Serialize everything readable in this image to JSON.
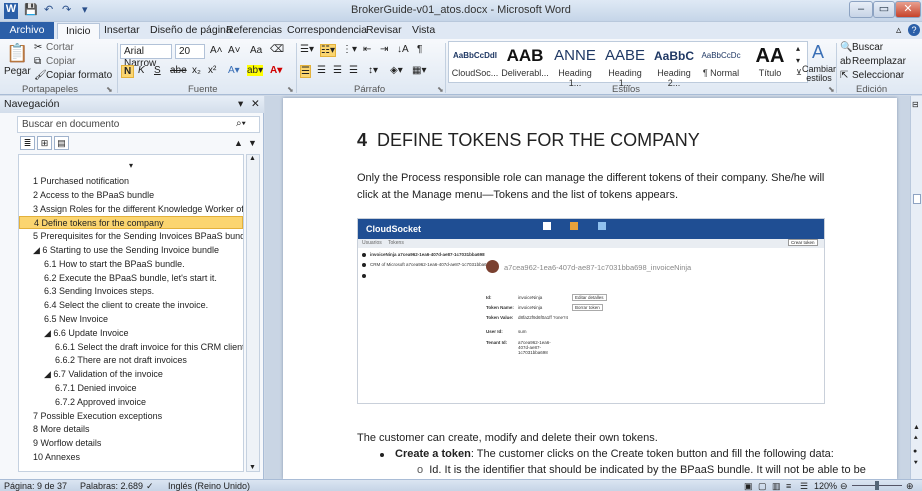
{
  "window": {
    "title": "BrokerGuide-v01_atos.docx - Microsoft Word",
    "app_letter": "W"
  },
  "ribbon_tabs": [
    "Archivo",
    "Inicio",
    "Insertar",
    "Diseño de página",
    "Referencias",
    "Correspondencia",
    "Revisar",
    "Vista"
  ],
  "ribbon": {
    "clipboard": {
      "paste": "Pegar",
      "cut": "Cortar",
      "copy": "Copiar",
      "format_painter": "Copiar formato",
      "label": "Portapapeles"
    },
    "font": {
      "name": "Arial Narrow",
      "size": "20",
      "bold": "N",
      "italic": "K",
      "underline": "S",
      "strike": "abe",
      "sub": "x₂",
      "sup": "x²",
      "grow": "A˄",
      "shrink": "A˅",
      "case": "Aa",
      "label": "Fuente"
    },
    "paragraph": {
      "label": "Párrafo"
    },
    "styles": {
      "items": [
        {
          "preview": "AaBbCcDdI",
          "name": "CloudSoc..."
        },
        {
          "preview": "AAB",
          "name": "Deliverabl..."
        },
        {
          "preview": "ANNE",
          "name": "Heading 1..."
        },
        {
          "preview": "AABE",
          "name": "Heading 1..."
        },
        {
          "preview": "AaBbC",
          "name": "Heading 2..."
        },
        {
          "preview": "AaBbCcDc",
          "name": "¶ Normal"
        },
        {
          "preview": "AA",
          "name": "Título"
        }
      ],
      "change": "Cambiar estilos",
      "label": "Estilos"
    },
    "editing": {
      "find": "Buscar",
      "replace": "Reemplazar",
      "select": "Seleccionar",
      "label": "Edición"
    }
  },
  "nav": {
    "title": "Navegación",
    "search_placeholder": "Buscar en documento",
    "items": [
      {
        "text": "1 Purchased notification",
        "level": 0
      },
      {
        "text": "2 Access to the BPaaS bundle",
        "level": 0
      },
      {
        "text": "3 Assign Roles for the different Knowledge Worker of the ...",
        "level": 0
      },
      {
        "text": "4 Define tokens for the company",
        "level": 0,
        "selected": true
      },
      {
        "text": "5 Prerequisites for the Sending Invoices BPaaS bundle.",
        "level": 0
      },
      {
        "text": "◢ 6 Starting to use the Sending Invoice bundle",
        "level": 0
      },
      {
        "text": "6.1 How to start the BPaaS bundle.",
        "level": 1
      },
      {
        "text": "6.2 Execute the BPaaS bundle, let's start it.",
        "level": 1
      },
      {
        "text": "6.3 Sending Invoices steps.",
        "level": 1
      },
      {
        "text": "6.4 Select the client to create the invoice.",
        "level": 1
      },
      {
        "text": "6.5 New Invoice",
        "level": 1
      },
      {
        "text": "◢ 6.6 Update Invoice",
        "level": 1
      },
      {
        "text": "6.6.1 Select the draft invoice for this CRM client",
        "level": 2
      },
      {
        "text": "6.6.2 There are not draft invoices",
        "level": 2
      },
      {
        "text": "◢ 6.7 Validation of the invoice",
        "level": 1
      },
      {
        "text": "6.7.1 Denied invoice",
        "level": 2
      },
      {
        "text": "6.7.2 Approved invoice",
        "level": 2
      },
      {
        "text": "7 Possible Execution exceptions",
        "level": 0
      },
      {
        "text": "8 More details",
        "level": 0
      },
      {
        "text": "9 Worflow details",
        "level": 0
      },
      {
        "text": "10 Annexes",
        "level": 0
      }
    ]
  },
  "document": {
    "heading_number": "4",
    "heading_text": "DEFINE TOKENS FOR THE COMPANY",
    "para1": "Only the Process responsible role can manage the different tokens of their company. She/he will click at the Manage menu—Tokens and the list of tokens appears.",
    "screenshot": {
      "brand": "CloudSocket",
      "menu_left": "Usuarios",
      "menu_right": "Tokens",
      "token_title": "a7cea962-1ea6-407d-ae87-1c7031bba698_invoiceNinja",
      "list_row1": "invoiceNinja a7cea962-1ea6-407d-ae87-1c7031bba698",
      "list_row2": "CRM of Microsoft a7cea962-1ea6-407d-ae87-1c7031bba6",
      "fields": [
        {
          "k": "Id:",
          "v": "invoiceNinja"
        },
        {
          "k": "Token Name:",
          "v": "invoiceNinja"
        },
        {
          "k": "Token Value:",
          "v": "d8fa22f9d6f0a1ff ?one?4"
        },
        {
          "k": "User Id:",
          "v": "sum"
        },
        {
          "k": "Tenant Id:",
          "v": "a7cea962-1ea6-407d-ae87-1c7031bba698"
        }
      ],
      "btn1": "Editar detalles",
      "btn2": "Borrar token",
      "btn_new": "Crear token"
    },
    "para2": "The customer can create, modify and delete their own tokens.",
    "bullet_bold": "Create a token",
    "bullet_rest": ": The customer clicks on the Create token button and fill the following data:",
    "sub_bullet": "Id. It is the identifier that should be indicated by the BPaaS bundle. It will not be able to be"
  },
  "status": {
    "page": "Página: 9 de 37",
    "words": "Palabras: 2.689",
    "language": "Inglés (Reino Unido)",
    "zoom": "120%"
  },
  "colors": {
    "accent": "#2b5fa8",
    "selected_nav": "#fbd570"
  }
}
